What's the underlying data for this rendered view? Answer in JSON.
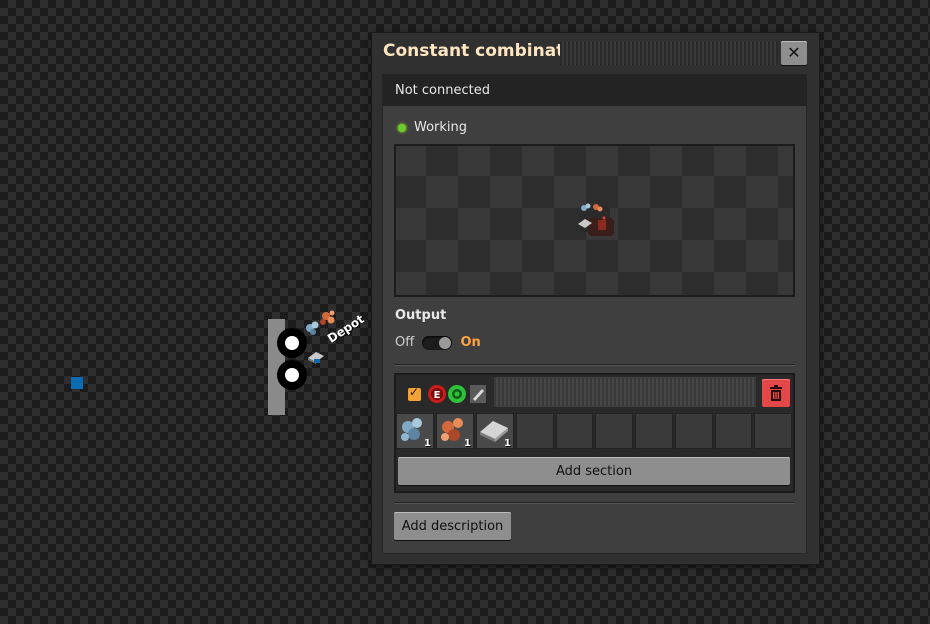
{
  "world": {
    "station_label": "Depot",
    "marker_color": "#0a6bb0"
  },
  "window": {
    "title": "Constant combinator",
    "close_icon": "close-icon",
    "connection_status": "Not connected",
    "working_status": "Working",
    "status_color": "#6ccb2a",
    "output": {
      "label": "Output",
      "off_label": "Off",
      "on_label": "On",
      "value": "On"
    },
    "section": {
      "enabled": true,
      "group_icons": [
        "e-signal-icon",
        "gear-signal-icon",
        "steel-plate-icon"
      ],
      "slots": [
        {
          "item": "iron-ore-icon",
          "count": "1"
        },
        {
          "item": "copper-ore-icon",
          "count": "1"
        },
        {
          "item": "steel-plate-icon",
          "count": "1"
        },
        {
          "item": "",
          "count": ""
        },
        {
          "item": "",
          "count": ""
        },
        {
          "item": "",
          "count": ""
        },
        {
          "item": "",
          "count": ""
        },
        {
          "item": "",
          "count": ""
        },
        {
          "item": "",
          "count": ""
        },
        {
          "item": "",
          "count": ""
        }
      ],
      "add_section_label": "Add section"
    },
    "add_description_label": "Add description"
  }
}
